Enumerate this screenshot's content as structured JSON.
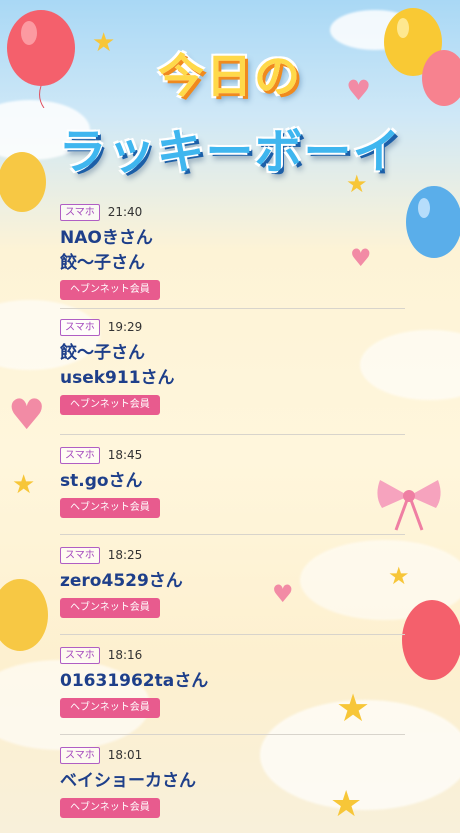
{
  "header": {
    "title_line1": "今日の",
    "title_line2": "ラッキーボーイ"
  },
  "colors": {
    "tag_border": "#b05ec4",
    "name_text": "#1e3f8a",
    "badge_bg": "#e85b8e"
  },
  "entries": [
    {
      "tag": "スマホ",
      "time": "21:40",
      "names": [
        "NAOきさん",
        "餃〜子さん"
      ],
      "badge": "ヘブンネット会員"
    },
    {
      "tag": "スマホ",
      "time": "19:29",
      "names": [
        "餃〜子さん",
        "usek911さん"
      ],
      "badge": "ヘブンネット会員"
    },
    {
      "tag": "スマホ",
      "time": "18:45",
      "names": [
        "st.goさん"
      ],
      "badge": "ヘブンネット会員"
    },
    {
      "tag": "スマホ",
      "time": "18:25",
      "names": [
        "zero4529さん"
      ],
      "badge": "ヘブンネット会員"
    },
    {
      "tag": "スマホ",
      "time": "18:16",
      "names": [
        "01631962taさん"
      ],
      "badge": "ヘブンネット会員"
    },
    {
      "tag": "スマホ",
      "time": "18:01",
      "names": [
        "ベイショーカさん"
      ],
      "badge": "ヘブンネット会員"
    }
  ]
}
